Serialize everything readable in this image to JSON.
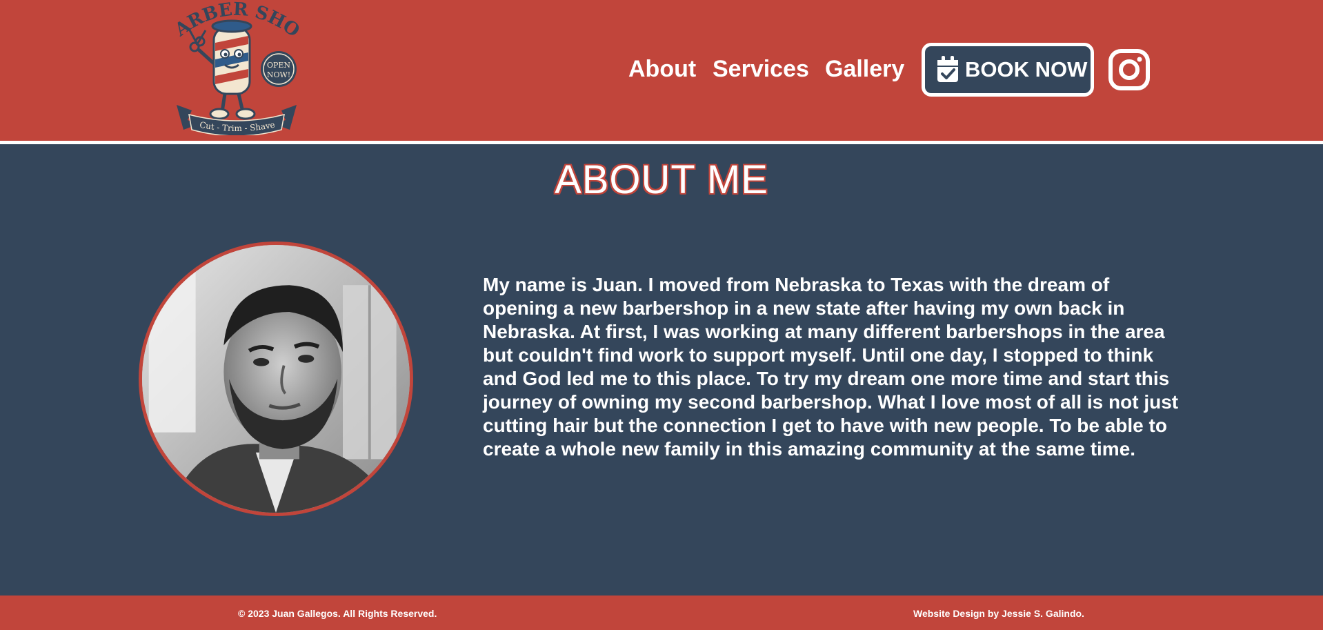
{
  "header": {
    "logo": {
      "top_text": "BARBER SHOP",
      "badge_text": "OPEN NOW!",
      "ribbon_text": "Cut - Trim - Shave"
    },
    "nav": [
      {
        "label": "About"
      },
      {
        "label": "Services"
      },
      {
        "label": "Gallery"
      }
    ],
    "book_now_label": "BOOK NOW",
    "book_now_icon": "calendar-check-icon",
    "social_icon": "instagram-icon"
  },
  "main": {
    "title": "ABOUT ME",
    "bio": "My name is Juan. I moved from Nebraska to Texas with the dream of opening a new barbershop in a new state after having my own back in Nebraska. At first, I was working at many different barbershops in the area but couldn't find work to support myself. Until one day, I stopped to think and God led me to this place. To try my dream one more time and start this journey of owning my second barbershop. What I love most of all is not just cutting hair but the connection I get to have with new people. To be able to create a whole new family in this amazing community at the same time."
  },
  "footer": {
    "copyright": "© 2023 Juan Gallegos. All Rights Reserved.",
    "credit": "Website Design by Jessie S. Galindo."
  },
  "colors": {
    "brand_red": "#c1453b",
    "navy": "#34465b",
    "white": "#ffffff"
  }
}
